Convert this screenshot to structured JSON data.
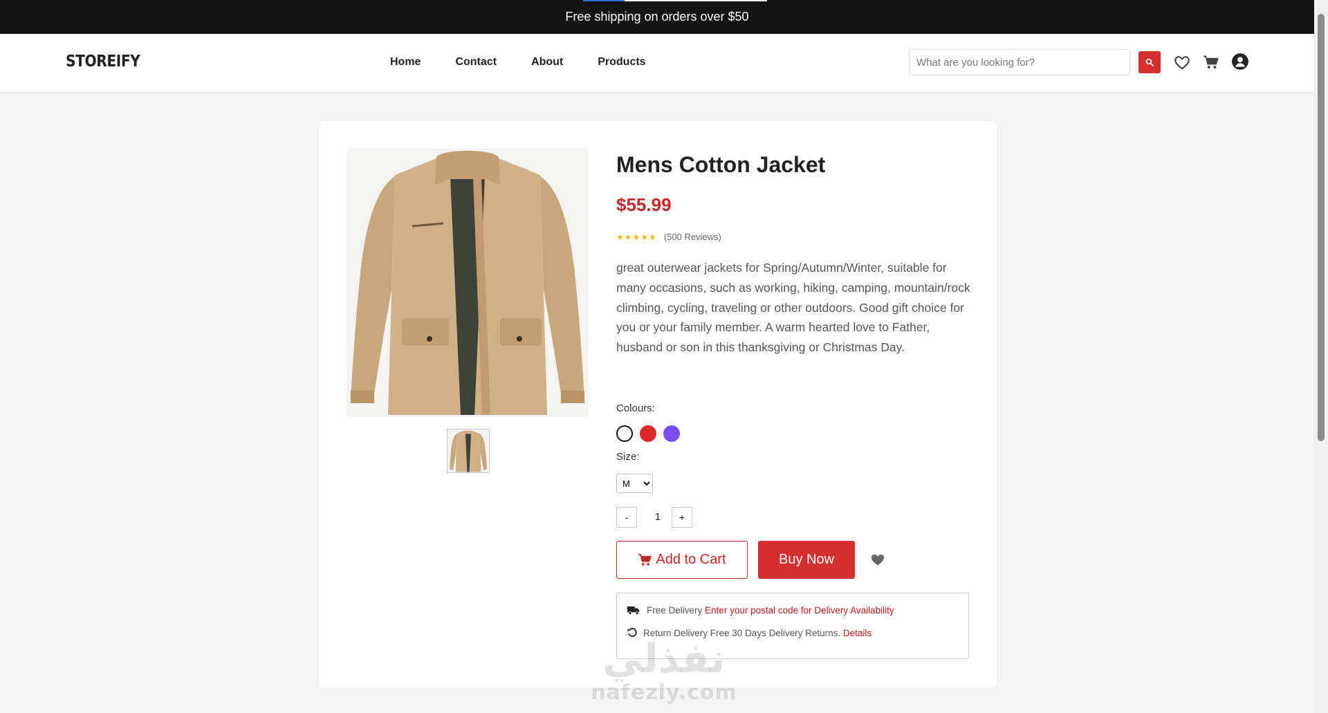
{
  "announcement": {
    "text": "Free shipping on orders over $50"
  },
  "header": {
    "logo": "STOREIFY",
    "nav": [
      {
        "label": "Home"
      },
      {
        "label": "Contact"
      },
      {
        "label": "About"
      },
      {
        "label": "Products"
      }
    ],
    "search": {
      "placeholder": "What are you looking for?",
      "value": ""
    },
    "icons": [
      "search-icon",
      "heart-icon",
      "cart-icon",
      "user-icon"
    ]
  },
  "product": {
    "title": "Mens Cotton Jacket",
    "price": "$55.99",
    "rating": {
      "stars": 5,
      "reviews_label": "(500 Reviews)"
    },
    "description": "great outerwear jackets for Spring/Autumn/Winter, suitable for many occasions, such as working, hiking, camping, mountain/rock climbing, cycling, traveling or other outdoors. Good gift choice for you or your family member. A warm hearted love to Father, husband or son in this thanksgiving or Christmas Day.",
    "colours_label": "Colours:",
    "colours": [
      "#ffffff",
      "#db2828",
      "#7b4cf0"
    ],
    "size_label": "Size:",
    "size_selected": "M",
    "quantity": {
      "minus": "-",
      "value": "1",
      "plus": "+"
    },
    "add_to_cart": "Add to Cart",
    "buy_now": "Buy Now"
  },
  "delivery": {
    "free_label": "Free Delivery",
    "free_link": "Enter your postal code for Delivery Availability",
    "return_label": "Return Delivery Free 30 Days Delivery Returns.",
    "return_link": "Details"
  },
  "watermark": {
    "arabic": "نفذلي",
    "latin": "nafezly.com"
  },
  "colors": {
    "accent": "#d32f2f",
    "price": "#c62828",
    "topbar": "#141414",
    "star": "#f2b705"
  }
}
